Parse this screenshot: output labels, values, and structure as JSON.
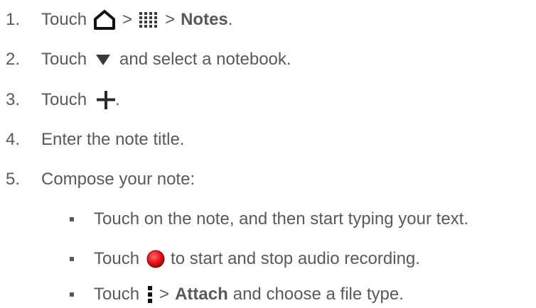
{
  "steps": [
    {
      "num": "1.",
      "before": "Touch",
      "sep1": ">",
      "sep2": ">",
      "target": "Notes",
      "end": ".",
      "icons": [
        "home-icon",
        "apps-grid-icon"
      ]
    },
    {
      "num": "2.",
      "before": "Touch",
      "after": "and select a notebook.",
      "icons": [
        "dropdown-triangle-icon"
      ]
    },
    {
      "num": "3.",
      "before": "Touch",
      "after": ".",
      "icons": [
        "plus-icon"
      ]
    },
    {
      "num": "4.",
      "text": "Enter the note title."
    },
    {
      "num": "5.",
      "text": "Compose your note:"
    }
  ],
  "substeps": [
    {
      "text": "Touch on the note, and then start typing your text."
    },
    {
      "before": "Touch",
      "after": "to start and stop audio recording.",
      "icons": [
        "record-icon"
      ]
    },
    {
      "before": "Touch",
      "sep": ">",
      "target": "Attach",
      "after": "and choose a file type.",
      "icons": [
        "menu-dots-icon"
      ]
    }
  ],
  "colors": {
    "text": "#595959",
    "icon": "#3a3a3a",
    "record": "#e8131b"
  }
}
